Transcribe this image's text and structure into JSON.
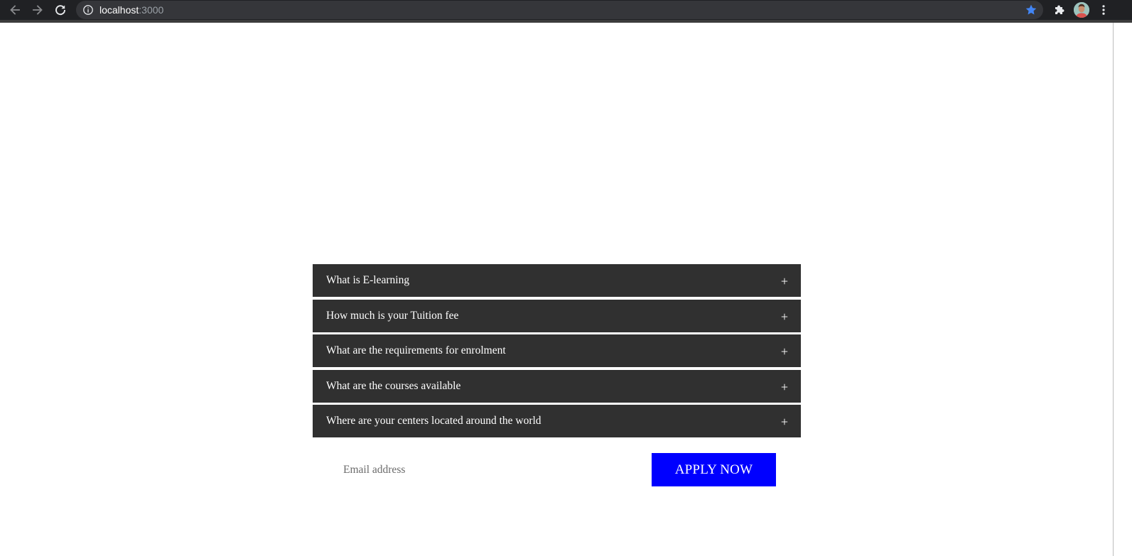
{
  "browser": {
    "url_host": "localhost",
    "url_port": ":3000",
    "icons": {
      "back": "arrow-left-icon",
      "forward": "arrow-right-icon",
      "reload": "reload-icon",
      "info": "info-icon",
      "bookmark": "star-icon",
      "extensions": "puzzle-icon",
      "menu": "kebab-menu-icon"
    },
    "colors": {
      "toolbar": "#202124",
      "omnibox": "#35363a",
      "star": "#4285f4"
    }
  },
  "faq": {
    "items": [
      {
        "question": "What is E-learning",
        "toggle": "+"
      },
      {
        "question": "How much is your Tuition fee",
        "toggle": "+"
      },
      {
        "question": "What are the requirements for enrolment",
        "toggle": "+"
      },
      {
        "question": "What are the courses available",
        "toggle": "+"
      },
      {
        "question": "Where are your centers located around the world",
        "toggle": "+"
      }
    ],
    "colors": {
      "item_bg": "#303030",
      "item_text": "#ffffff"
    }
  },
  "apply_form": {
    "email_placeholder": "Email address",
    "email_value": "",
    "button_label": "APPLY NOW",
    "button_color": "#0000ff"
  }
}
